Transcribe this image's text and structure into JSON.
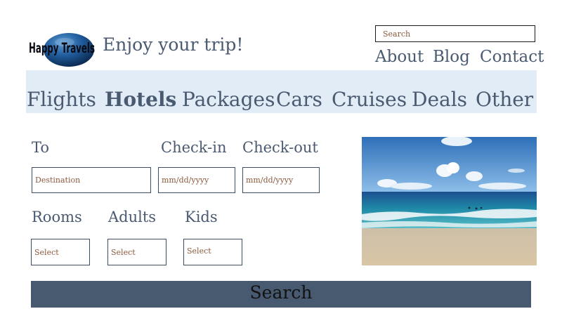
{
  "logo": {
    "text": "Happy Travels"
  },
  "header": {
    "tagline": "Enjoy your trip!",
    "search_placeholder": "Search",
    "nav": [
      "About",
      "Blog",
      "Contact"
    ]
  },
  "categories": {
    "items": [
      "Flights",
      "Hotels",
      "Packages",
      "Cars",
      "Cruises",
      "Deals",
      "Other"
    ],
    "active": "Hotels"
  },
  "form": {
    "to_label": "To",
    "to_placeholder": "Destination",
    "checkin_label": "Check-in",
    "checkin_placeholder": "mm/dd/yyyy",
    "checkout_label": "Check-out",
    "checkout_placeholder": "mm/dd/yyyy",
    "rooms_label": "Rooms",
    "rooms_value": "Select",
    "adults_label": "Adults",
    "adults_value": "Select",
    "kids_label": "Kids",
    "kids_value": "Select",
    "submit_label": "Search"
  },
  "colors": {
    "text": "#4a5a70",
    "nav_bar_bg": "#e2ecf7",
    "button_bg": "#485a70",
    "placeholder": "#8a5a3c"
  }
}
